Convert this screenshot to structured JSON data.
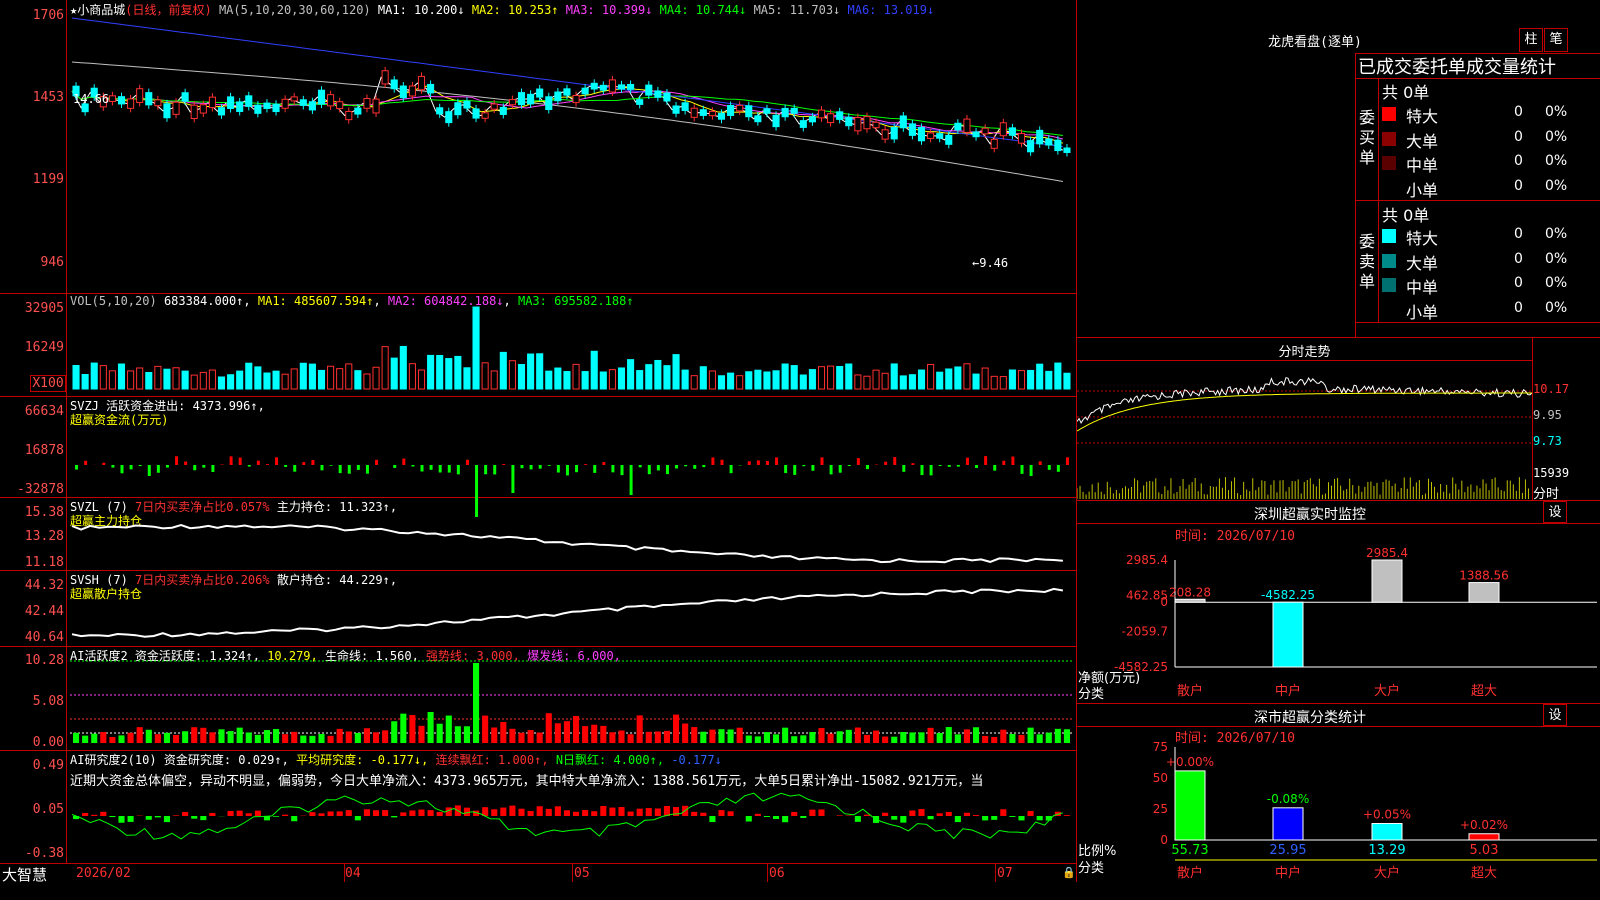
{
  "stock": {
    "name": "小商品城",
    "period": "(日线，前复权)",
    "ma_params": "MA(5,10,20,30,60,120)",
    "ma": [
      {
        "label": "MA1:",
        "value": "10.200↓",
        "color": "#ffffff"
      },
      {
        "label": "MA2:",
        "value": "10.253↑",
        "color": "#ffff00"
      },
      {
        "label": "MA3:",
        "value": "10.399↓",
        "color": "#ff40ff"
      },
      {
        "label": "MA4:",
        "value": "10.744↓",
        "color": "#00ff00"
      },
      {
        "label": "MA5:",
        "value": "11.703↓",
        "color": "#c0c0c0"
      },
      {
        "label": "MA6:",
        "value": "13.019↓",
        "color": "#3040ff"
      }
    ],
    "high_mark": "14.66",
    "low_mark": "←9.46"
  },
  "axes": {
    "price": [
      "1706",
      "1453",
      "1199",
      "946"
    ],
    "vol": [
      "32905",
      "16249",
      "X100"
    ],
    "svzj": [
      "66634",
      "16878",
      "-32878"
    ],
    "svzl": [
      "15.38",
      "13.28",
      "11.18"
    ],
    "svsh": [
      "44.32",
      "42.44",
      "40.64"
    ],
    "ai": [
      "10.28",
      "5.08",
      "0.00"
    ],
    "ai2": [
      "0.49",
      "0.05",
      "-0.38"
    ]
  },
  "panels": {
    "vol": {
      "name": "VOL(5,10,20)",
      "v": "683384.000↑",
      "ma1": "MA1: 485607.594↑",
      "ma2": "MA2: 604842.188↓",
      "ma3": "MA3: 695582.188↑"
    },
    "svzj": {
      "line1": "SVZJ  活跃资金进出: 4373.996↑,",
      "line2": "超赢资金流(万元)"
    },
    "svzl": {
      "name": "SVZL (7)",
      "red": "7日内买卖净占比0.057%",
      "white": "主力持仓: 11.323↑,",
      "line2": "超赢主力持仓"
    },
    "svsh": {
      "name": "SVSH (7)",
      "red": "7日内买卖净占比0.206%",
      "white": "散户持仓: 44.229↑,",
      "line2": "超赢散户持仓"
    },
    "ai": {
      "name": "AI活跃度2",
      "p1": "资金活跃度: 1.324↑,",
      "p2": "10.279,",
      "p3": "生命线: 1.560,",
      "p4": "强势线: 3.000,",
      "p5": "爆发线: 6.000,"
    },
    "ai2": {
      "name": "AI研究度2(10)",
      "p1": "资金研究度: 0.029↑,",
      "p2": "平均研究度: -0.177↓,",
      "p3": "连续飘红: 1.000↑,",
      "p4": "N日飘红: 4.000↑,",
      "p5": "-0.177↓",
      "comment": "近期大资金总体偏空，异动不明显，偏弱势，今日大单净流入：4373.965万元，其中特大单净流入：1388.561万元，大单5日累计净出-15082.921万元，当"
    }
  },
  "xaxis": {
    "brand": "大智慧",
    "labels": [
      "2026/02",
      "04",
      "05",
      "06",
      "07"
    ]
  },
  "right": {
    "dragon_title": "龙虎看盘(逐单)",
    "btn1": "柱",
    "btn2": "笔",
    "table_title": "已成交委托单成交量统计",
    "buy": {
      "side": "委买单",
      "total": "共 0单",
      "rows": [
        {
          "name": "特大",
          "v": "0",
          "p": "0%",
          "color": "#ff0000"
        },
        {
          "name": "大单",
          "v": "0",
          "p": "0%",
          "color": "#8b0000"
        },
        {
          "name": "中单",
          "v": "0",
          "p": "0%",
          "color": "#5a0000"
        },
        {
          "name": "小单",
          "v": "0",
          "p": "0%",
          "color": ""
        }
      ]
    },
    "sell": {
      "side": "委卖单",
      "total": "共 0单",
      "rows": [
        {
          "name": "特大",
          "v": "0",
          "p": "0%",
          "color": "#00ffff"
        },
        {
          "name": "大单",
          "v": "0",
          "p": "0%",
          "color": "#008b8b"
        },
        {
          "name": "中单",
          "v": "0",
          "p": "0%",
          "color": "#007070"
        },
        {
          "name": "小单",
          "v": "0",
          "p": "0%",
          "color": ""
        }
      ]
    },
    "intraday": {
      "title": "分时走势",
      "axis": [
        "10.17",
        "9.95",
        "9.73",
        "15939",
        "分时"
      ]
    },
    "sz_monitor": {
      "title": "深圳超赢实时监控",
      "btn": "设",
      "time": "时间: 2026/07/10",
      "axis": [
        "2985.4",
        "462.85",
        "0",
        "-2059.7",
        "-4582.25"
      ],
      "ylabel": "净额(万元)",
      "xlabel": "分类"
    },
    "sz_class": {
      "title": "深市超赢分类统计",
      "btn": "设",
      "time": "时间: 2026/07/10",
      "axis": [
        "75",
        "50",
        "25",
        "0"
      ],
      "ylabel": "比例%",
      "xlabel": "分类"
    }
  },
  "chart_data": [
    {
      "type": "bar",
      "title": "深圳超赢实时监控",
      "categories": [
        "散户",
        "中户",
        "大户",
        "超大"
      ],
      "values": [
        208.28,
        -4582.25,
        2985.4,
        1388.56
      ],
      "ylim": [
        -4582.25,
        2985.4
      ],
      "ylabel": "净额(万元)",
      "xlabel": "分类",
      "colors": [
        "#c0c0c0",
        "#00ffff",
        "#c0c0c0",
        "#c0c0c0"
      ]
    },
    {
      "type": "bar",
      "title": "深市超赢分类统计",
      "categories": [
        "散户",
        "中户",
        "大户",
        "超大"
      ],
      "values": [
        55.73,
        25.95,
        13.29,
        5.03
      ],
      "changes": [
        "+0.00%",
        "-0.08%",
        "+0.05%",
        "+0.02%"
      ],
      "ylim": [
        0,
        75
      ],
      "ylabel": "比例%",
      "xlabel": "分类",
      "colors": [
        "#00ff00",
        "#0000ff",
        "#00ffff",
        "#ff0000"
      ]
    }
  ]
}
